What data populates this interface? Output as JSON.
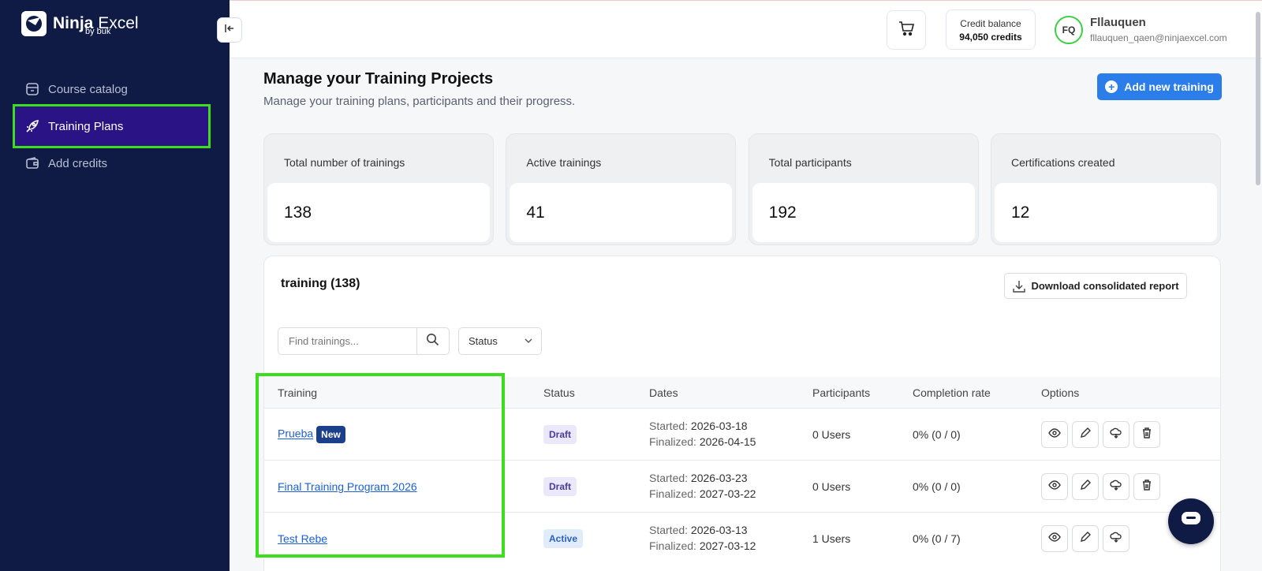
{
  "brand": {
    "name_bold": "Ninja",
    "name_light": "Excel",
    "by": "by buk"
  },
  "sidebar": {
    "items": [
      {
        "label": "Course catalog",
        "icon": "store-icon"
      },
      {
        "label": "Training Plans",
        "icon": "rocket-icon",
        "active": true
      },
      {
        "label": "Add credits",
        "icon": "wallet-icon"
      }
    ]
  },
  "header": {
    "credit_label": "Credit balance",
    "credit_value": "94,050 credits",
    "avatar_initials": "FQ",
    "user_name": "Fllauquen",
    "user_email": "fllauquen_qaen@ninjaexcel.com"
  },
  "page": {
    "title": "Manage your Training Projects",
    "subtitle": "Manage your training plans, participants and their progress.",
    "add_button": "Add new training"
  },
  "stats": [
    {
      "label": "Total number of trainings",
      "value": "138"
    },
    {
      "label": "Active trainings",
      "value": "41"
    },
    {
      "label": "Total participants",
      "value": "192"
    },
    {
      "label": "Certifications created",
      "value": "12"
    }
  ],
  "table": {
    "title": "training (138)",
    "download_button": "Download consolidated report",
    "search_placeholder": "Find trainings...",
    "status_filter": "Status",
    "headers": [
      "Training",
      "Status",
      "Dates",
      "Participants",
      "Completion rate",
      "Options"
    ],
    "rows": [
      {
        "name": "Prueba",
        "badge": "New",
        "status": "Draft",
        "started_label": "Started:",
        "started": "2026-03-18",
        "finalized_label": "Finalized:",
        "finalized": "2026-04-15",
        "participants": "0 Users",
        "completion": "0% (0 / 0)"
      },
      {
        "name": "Final Training Program 2026",
        "status": "Draft",
        "started_label": "Started:",
        "started": "2026-03-23",
        "finalized_label": "Finalized:",
        "finalized": "2027-03-22",
        "participants": "0 Users",
        "completion": "0% (0 / 0)"
      },
      {
        "name": "Test Rebe",
        "status": "Active",
        "started_label": "Started:",
        "started": "2026-03-13",
        "finalized_label": "Finalized:",
        "finalized": "2027-03-12",
        "participants": "1 Users",
        "completion": "0% (0 / 7)"
      }
    ]
  },
  "colors": {
    "sidebar_bg": "#0f1a45",
    "active_item": "#2a1485",
    "primary": "#2b7de9",
    "highlight": "#3ddc1f"
  }
}
